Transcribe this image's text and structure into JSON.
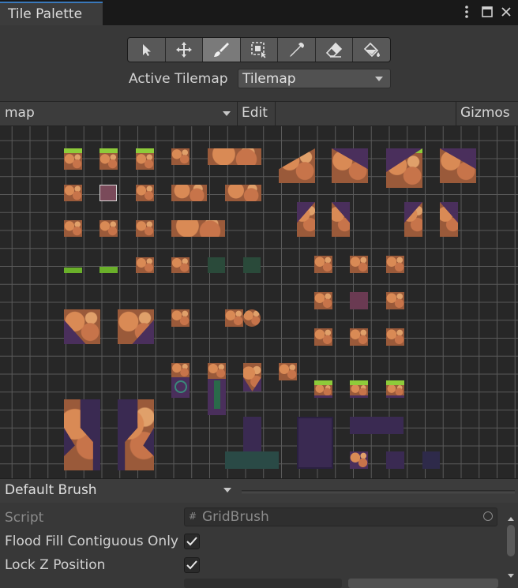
{
  "window": {
    "tab_title": "Tile Palette",
    "icons": [
      "more-vert-icon",
      "maximize-icon",
      "close-icon"
    ]
  },
  "toolbar": {
    "tools": [
      {
        "name": "select-tool",
        "icon": "arrow-icon"
      },
      {
        "name": "move-tool",
        "icon": "move-icon"
      },
      {
        "name": "paint-tool",
        "icon": "brush-icon",
        "active": true
      },
      {
        "name": "box-fill-tool",
        "icon": "box-select-icon"
      },
      {
        "name": "picker-tool",
        "icon": "eyedropper-icon"
      },
      {
        "name": "erase-tool",
        "icon": "eraser-icon"
      },
      {
        "name": "fill-tool",
        "icon": "bucket-icon"
      }
    ]
  },
  "active_tilemap": {
    "label": "Active Tilemap",
    "value": "Tilemap"
  },
  "palette_bar": {
    "palette": "map",
    "edit_label": "Edit",
    "gizmos_label": "Gizmos"
  },
  "brush": {
    "selected": "Default Brush"
  },
  "inspector": {
    "script_label": "Script",
    "script_value": "GridBrush",
    "flood_fill_label": "Flood Fill Contiguous Only",
    "flood_fill_checked": true,
    "lock_z_label": "Lock Z Position",
    "lock_z_checked": true
  },
  "colors": {
    "accent": "#3a79bb",
    "grass": "#8ecb3a",
    "dirt": "#c7744a",
    "panel": "#383838"
  }
}
